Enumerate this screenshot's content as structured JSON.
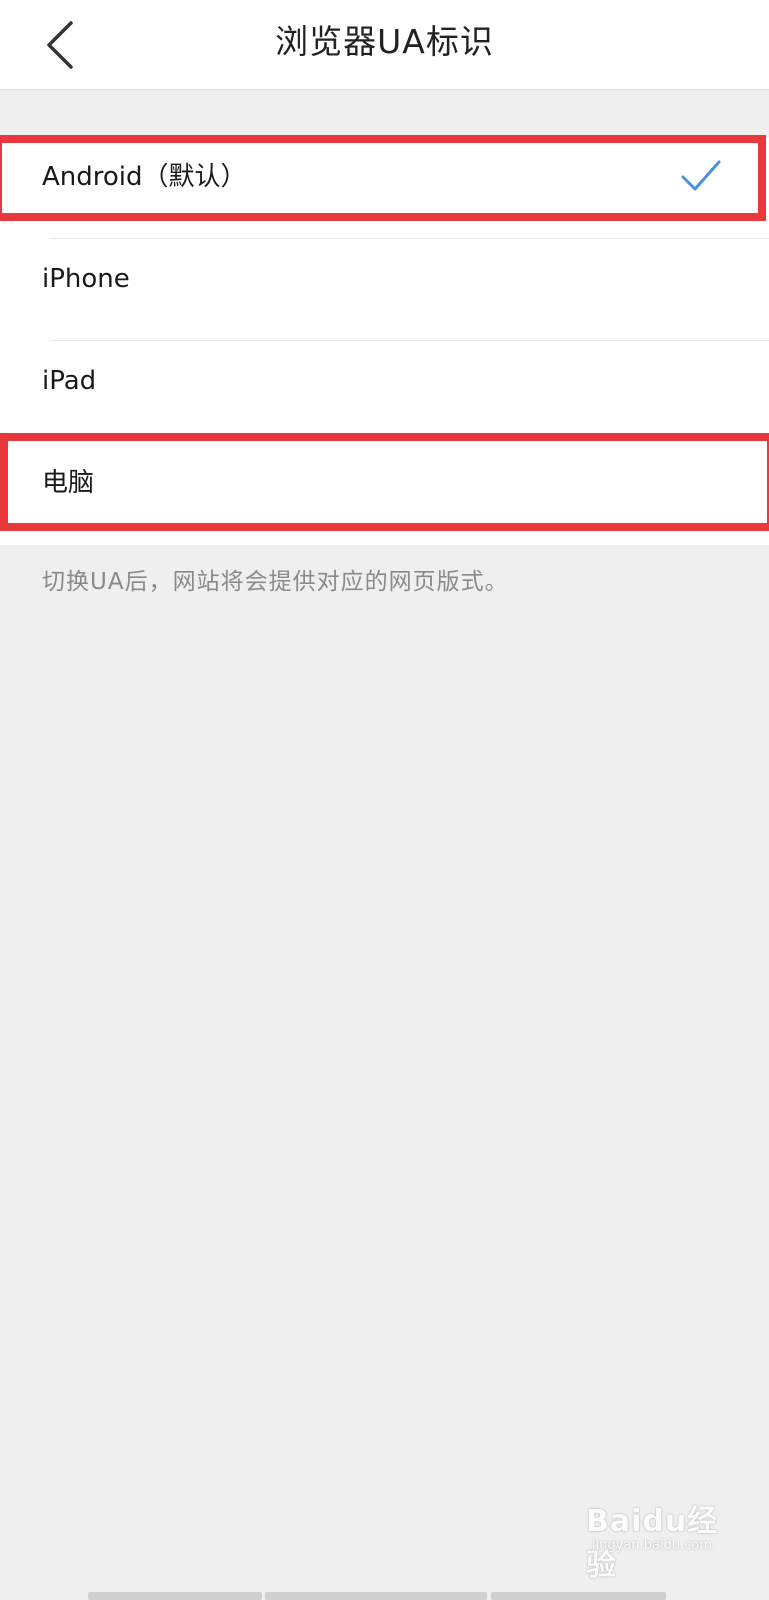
{
  "header": {
    "title": "浏览器UA标识",
    "back_icon": "chevron-left-icon"
  },
  "options": [
    {
      "label": "Android（默认）",
      "selected": true
    },
    {
      "label": "iPhone",
      "selected": false
    },
    {
      "label": "iPad",
      "selected": false
    },
    {
      "label": "电脑",
      "selected": false
    }
  ],
  "hint": "切换UA后，网站将会提供对应的网页版式。",
  "watermark": {
    "main": "Baidu经验",
    "sub": "jingyan.baidu.com"
  },
  "colors": {
    "accent_check": "#4a90e2",
    "highlight": "#e8383b",
    "background": "#efefef"
  }
}
